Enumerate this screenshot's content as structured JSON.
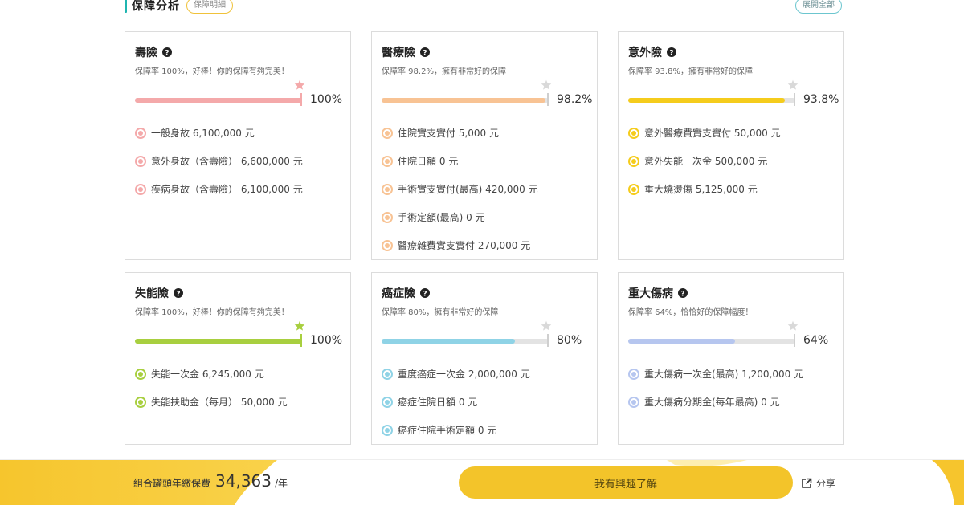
{
  "header": {
    "title": "保障分析",
    "detail_label": "保障明細",
    "expand_label": "展開全部"
  },
  "cards": [
    {
      "title": "壽險",
      "desc": "保障率 100%，好棒！你的保障有夠完美！",
      "percent_text": "100%",
      "ratio": 1.0,
      "color": "#f4a9aa",
      "star_color": "#f4a9aa",
      "items": [
        "一般身故 6,100,000 元",
        "意外身故（含壽險） 6,600,000 元",
        "疾病身故（含壽險） 6,100,000 元"
      ]
    },
    {
      "title": "醫療險",
      "desc": "保障率 98.2%，擁有非常好的保障",
      "percent_text": "98.2%",
      "ratio": 0.982,
      "color": "#f8c394",
      "star_color": "#d9d9d9",
      "items": [
        "住院實支實付 5,000 元",
        "住院日額 0 元",
        "手術實支實付(最高) 420,000 元",
        "手術定額(最高) 0 元",
        "醫療雜費實支實付 270,000 元"
      ]
    },
    {
      "title": "意外險",
      "desc": "保障率 93.8%，擁有非常好的保障",
      "percent_text": "93.8%",
      "ratio": 0.938,
      "color": "#f5cc1c",
      "star_color": "#d9d9d9",
      "items": [
        "意外醫療費實支實付 50,000 元",
        "意外失能一次金 500,000 元",
        "重大燒燙傷 5,125,000 元"
      ]
    },
    {
      "title": "失能險",
      "desc": "保障率 100%，好棒！你的保障有夠完美！",
      "percent_text": "100%",
      "ratio": 1.0,
      "color": "#a8cf3f",
      "star_color": "#a8cf3f",
      "items": [
        "失能一次金 6,245,000 元",
        "失能扶助金（每月） 50,000 元"
      ]
    },
    {
      "title": "癌症險",
      "desc": "保障率 80%，擁有非常好的保障",
      "percent_text": "80%",
      "ratio": 0.8,
      "color": "#8fd3e6",
      "star_color": "#d9d9d9",
      "items": [
        "重度癌症一次金 2,000,000 元",
        "癌症住院日額 0 元",
        "癌症住院手術定額 0 元"
      ]
    },
    {
      "title": "重大傷病",
      "desc": "保障率 64%，恰恰好的保障幅度！",
      "percent_text": "64%",
      "ratio": 0.64,
      "color": "#b6c6ef",
      "star_color": "#d9d9d9",
      "items": [
        "重大傷病一次金(最高) 1,200,000 元",
        "重大傷病分期金(每年最高) 0 元"
      ]
    }
  ],
  "footer": {
    "premium_label": "組合罐頭年繳保費",
    "premium_amount": "34,363",
    "premium_unit": "/年",
    "cta_label": "我有興趣了解",
    "share_label": "分享"
  },
  "colors": {
    "accent": "#1fb5b0",
    "cta": "#f3c42a",
    "footer_wave": "#f6c52d"
  }
}
